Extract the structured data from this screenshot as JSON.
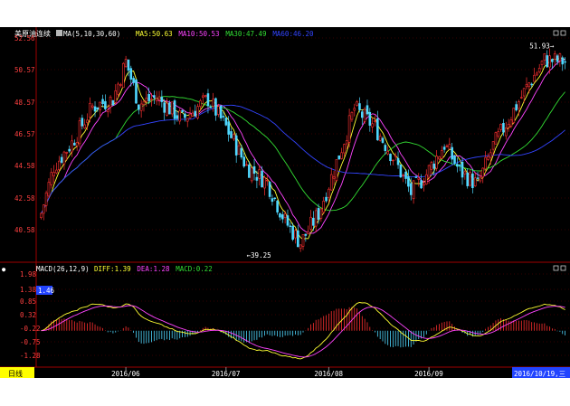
{
  "chart_data": [
    {
      "type": "candlestick",
      "name": "美原油连续",
      "indicator_label": "MA(5,10,30,60)",
      "ma_readout": [
        {
          "label": "MA5:",
          "value": "50.63",
          "color": "#ffff33"
        },
        {
          "label": "MA10:",
          "value": "50.53",
          "color": "#ff44ff"
        },
        {
          "label": "MA30:",
          "value": "47.49",
          "color": "#33dd33"
        },
        {
          "label": "MA60:",
          "value": "46.20",
          "color": "#3344ff"
        }
      ],
      "y_ticks": [
        "52.56",
        "50.57",
        "48.57",
        "46.57",
        "44.58",
        "42.58",
        "40.58"
      ],
      "ylim": [
        38.6,
        52.7
      ],
      "annotations": [
        {
          "text": "51.93",
          "x": 200,
          "y": 51.93
        },
        {
          "text": "39.25",
          "x": 80,
          "y": 39.25
        }
      ],
      "colors": {
        "up": "#ff3030",
        "down": "#4fd8ff",
        "ma5": "#ffff33",
        "ma10": "#ff44ff",
        "ma30": "#33dd33",
        "ma60": "#3344ff"
      }
    },
    {
      "type": "macd",
      "label": "MACD(26,12,9)",
      "readout": [
        {
          "label": "DIFF:",
          "value": "1.39",
          "color": "#ffff33"
        },
        {
          "label": "DEA:",
          "value": "1.28",
          "color": "#ff44ff"
        },
        {
          "label": "MACD:",
          "value": "0.22",
          "color": "#33dd33"
        }
      ],
      "y_ticks": [
        "1.98",
        "1.38",
        "0.85",
        "0.32",
        "-0.22",
        "-0.75",
        "-1.28"
      ],
      "ylim": [
        -1.85,
        2.1
      ],
      "current_value_label": "1.46",
      "colors": {
        "diff": "#ffff33",
        "dea": "#ff44ff",
        "pos": "#ff3030",
        "neg": "#4fd8ff"
      }
    }
  ],
  "x_axis": {
    "period_label": "日线",
    "months": [
      {
        "label": "2016/06",
        "x": 33
      },
      {
        "label": "2016/07",
        "x": 72
      },
      {
        "label": "2016/08",
        "x": 112
      },
      {
        "label": "2016/09",
        "x": 151
      }
    ],
    "cursor_date": "2016/10/19,三"
  }
}
